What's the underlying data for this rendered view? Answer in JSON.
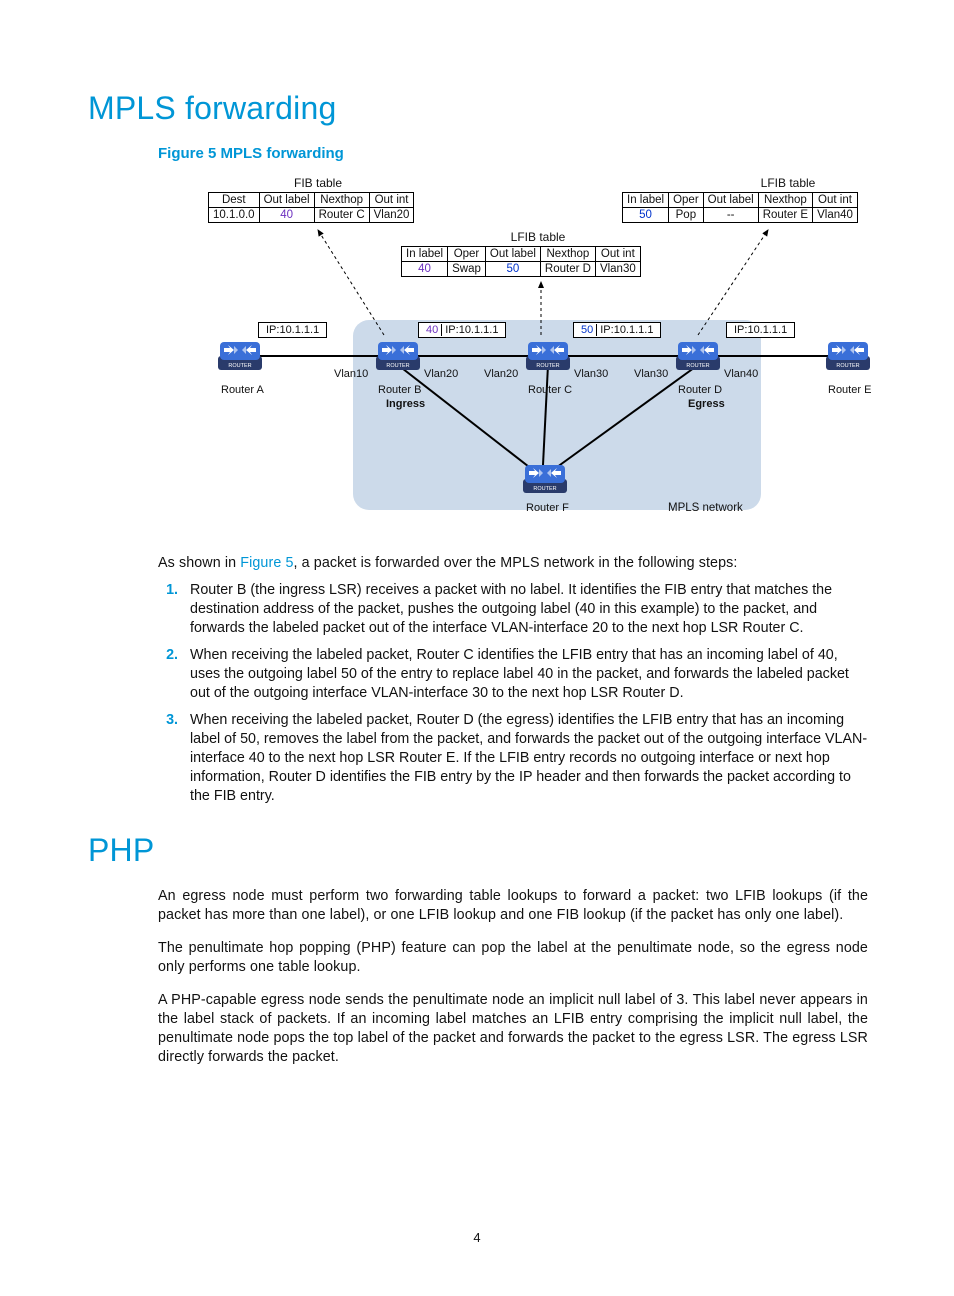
{
  "headings": {
    "h1a": "MPLS forwarding",
    "h1b": "PHP",
    "figcap": "Figure 5 MPLS forwarding"
  },
  "diagram": {
    "titles": {
      "fib": "FIB table",
      "lfib1": "LFIB table",
      "lfib2": "LFIB table"
    },
    "fib": {
      "hdr": [
        "Dest",
        "Out label",
        "Nexthop",
        "Out int"
      ],
      "row": [
        "10.1.0.0",
        "40",
        "Router C",
        "Vlan20"
      ]
    },
    "lfib_c": {
      "hdr": [
        "In label",
        "Oper",
        "Out label",
        "Nexthop",
        "Out int"
      ],
      "row": [
        "40",
        "Swap",
        "50",
        "Router D",
        "Vlan30"
      ]
    },
    "lfib_d": {
      "hdr": [
        "In label",
        "Oper",
        "Out label",
        "Nexthop",
        "Out int"
      ],
      "row": [
        "50",
        "Pop",
        "--",
        "Router E",
        "Vlan40"
      ]
    },
    "packets": {
      "a": {
        "ip": "IP:10.1.1.1"
      },
      "b": {
        "label": "40",
        "ip": "IP:10.1.1.1"
      },
      "c": {
        "label": "50",
        "ip": "IP:10.1.1.1"
      },
      "d": {
        "ip": "IP:10.1.1.1"
      }
    },
    "routers": {
      "a": {
        "name": "Router A",
        "role": ""
      },
      "b": {
        "name": "Router B",
        "role": "Ingress"
      },
      "c": {
        "name": "Router C",
        "role": ""
      },
      "d": {
        "name": "Router D",
        "role": "Egress"
      },
      "e": {
        "name": "Router E",
        "role": ""
      },
      "f": {
        "name": "Router F",
        "role": ""
      }
    },
    "ports": {
      "b_in": "Vlan10",
      "b_out": "Vlan20",
      "c_in": "Vlan20",
      "c_out": "Vlan30",
      "d_in": "Vlan30",
      "d_out": "Vlan40"
    },
    "mpls_net": "MPLS network"
  },
  "para_intro": [
    "As shown in ",
    "Figure 5",
    ", a packet is forwarded over the MPLS network in the following steps:"
  ],
  "steps": [
    "Router B (the ingress LSR) receives a packet with no label. It identifies the FIB entry that matches the destination address of the packet, pushes the outgoing label (40 in this example) to the packet, and forwards the labeled packet out of the interface VLAN-interface 20 to the next hop LSR Router C.",
    "When receiving the labeled packet, Router C identifies the LFIB entry that has an incoming label of 40, uses the outgoing label 50 of the entry to replace label 40 in the packet, and forwards the labeled packet out of the outgoing interface VLAN-interface 30 to the next hop LSR Router D.",
    "When receiving the labeled packet, Router D (the egress) identifies the LFIB entry that has an incoming label of 50, removes the label from the packet, and forwards the packet out of the outgoing interface VLAN-interface 40 to the next hop LSR Router E. If the LFIB entry records no outgoing interface or next hop information, Router D identifies the FIB entry by the IP header and then forwards the packet according to the FIB entry."
  ],
  "php_paras": [
    "An egress node must perform two forwarding table lookups to forward a packet: two LFIB lookups (if the packet has more than one label), or one LFIB lookup and one FIB lookup (if the packet has only one label).",
    "The penultimate hop popping (PHP) feature can pop the label at the penultimate node, so the egress node only performs one table lookup.",
    "A PHP-capable egress node sends the penultimate node an implicit null label of 3. This label never appears in the label stack of packets. If an incoming label matches an LFIB entry comprising the implicit null label, the penultimate node pops the top label of the packet and forwards the packet to the egress LSR. The egress LSR directly forwards the packet."
  ],
  "pageno": "4"
}
